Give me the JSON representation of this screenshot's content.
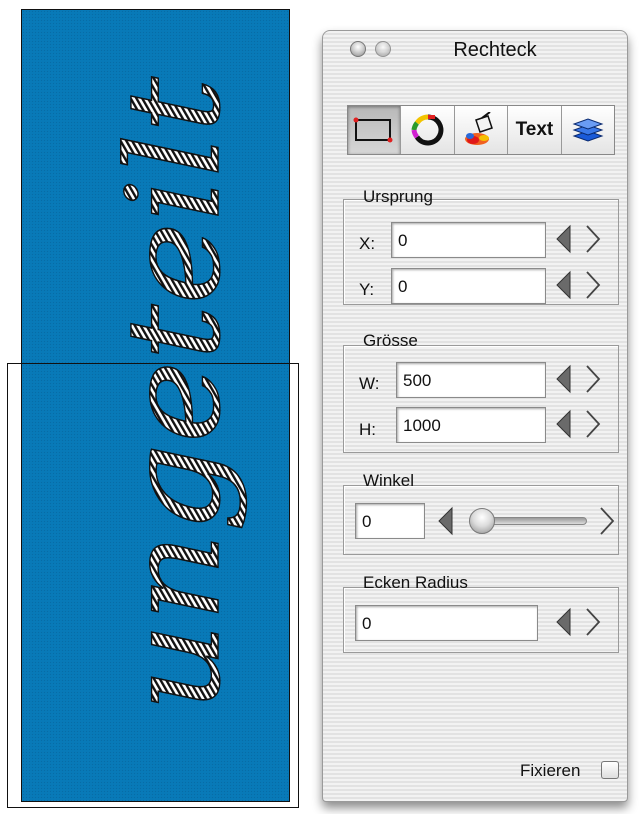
{
  "canvas": {
    "word": "ungeteilt",
    "fill_color": "#0a86c8"
  },
  "window": {
    "title": "Rechteck"
  },
  "toolbar": {
    "tools": [
      {
        "icon": "rectangle-icon",
        "active": true
      },
      {
        "icon": "color-wheel-icon",
        "active": false
      },
      {
        "icon": "paint-bucket-icon",
        "active": false
      },
      {
        "label": "Text",
        "active": false
      },
      {
        "icon": "layers-icon",
        "active": false
      }
    ]
  },
  "ursprung": {
    "label": "Ursprung",
    "x_label": "X:",
    "x_value": "0",
    "y_label": "Y:",
    "y_value": "0"
  },
  "groesse": {
    "label": "Grösse",
    "w_label": "W:",
    "w_value": "500",
    "h_label": "H:",
    "h_value": "1000"
  },
  "winkel": {
    "label": "Winkel",
    "value": "0",
    "slider_fraction": 0
  },
  "ecken": {
    "label": "Ecken Radius",
    "value": "0"
  },
  "fixieren": {
    "label": "Fixieren",
    "checked": false
  }
}
